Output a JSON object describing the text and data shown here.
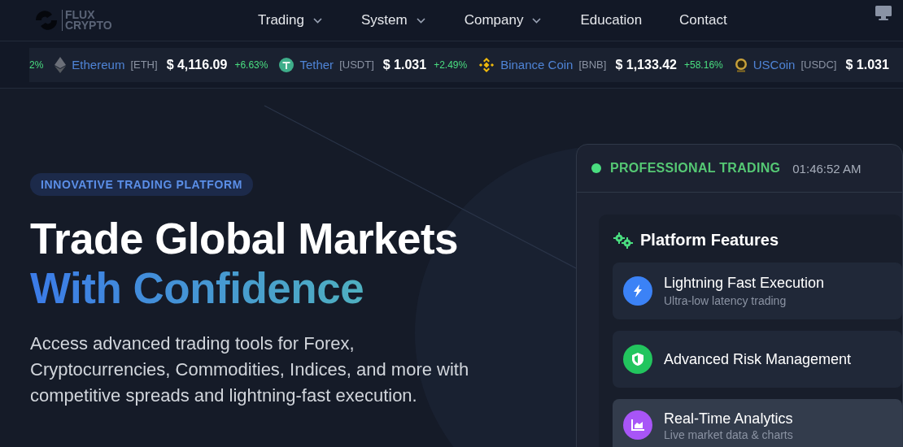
{
  "logo": {
    "line_1": "FLUX",
    "line_2": "CRYPTO"
  },
  "nav": [
    {
      "label": "Trading",
      "dropdown": true
    },
    {
      "label": "System",
      "dropdown": true
    },
    {
      "label": "Company",
      "dropdown": true
    },
    {
      "label": "Education",
      "dropdown": false
    },
    {
      "label": "Contact",
      "dropdown": false
    }
  ],
  "ticker": [
    {
      "change": "2%"
    },
    {
      "kind": "eth",
      "name": "Ethereum",
      "symbol": "[ETH]",
      "price": "$ 4,116.09",
      "change": "+6.63%"
    },
    {
      "kind": "usdt",
      "name": "Tether",
      "symbol": "[USDT]",
      "price": "$ 1.031",
      "change": "+2.49%"
    },
    {
      "kind": "bnb",
      "name": "Binance Coin",
      "symbol": "[BNB]",
      "price": "$ 1,133.42",
      "change": "+58.16%"
    },
    {
      "kind": "usdc",
      "name": "USCoin",
      "symbol": "[USDC]",
      "price": "$ 1.031"
    }
  ],
  "hero": {
    "badge": "INNOVATIVE TRADING PLATFORM",
    "title_line_1": "Trade Global Markets",
    "title_line_2": "With Confidence",
    "text": "Access advanced trading tools for Forex, Cryptocurrencies, Commodities, Indices, and more with competitive spreads and lightning-fast execution."
  },
  "panel": {
    "status": "PROFESSIONAL TRADING",
    "time": "01:46:52 AM",
    "features_title": "Platform Features",
    "features": [
      {
        "kind": "bolt",
        "title": "Lightning Fast Execution",
        "subtitle": "Ultra-low latency trading",
        "selected": false
      },
      {
        "kind": "shield",
        "title": "Advanced Risk Management",
        "selected": false
      },
      {
        "kind": "chart",
        "title": "Real-Time Analytics",
        "subtitle": "Live market data & charts",
        "selected": true
      }
    ]
  }
}
